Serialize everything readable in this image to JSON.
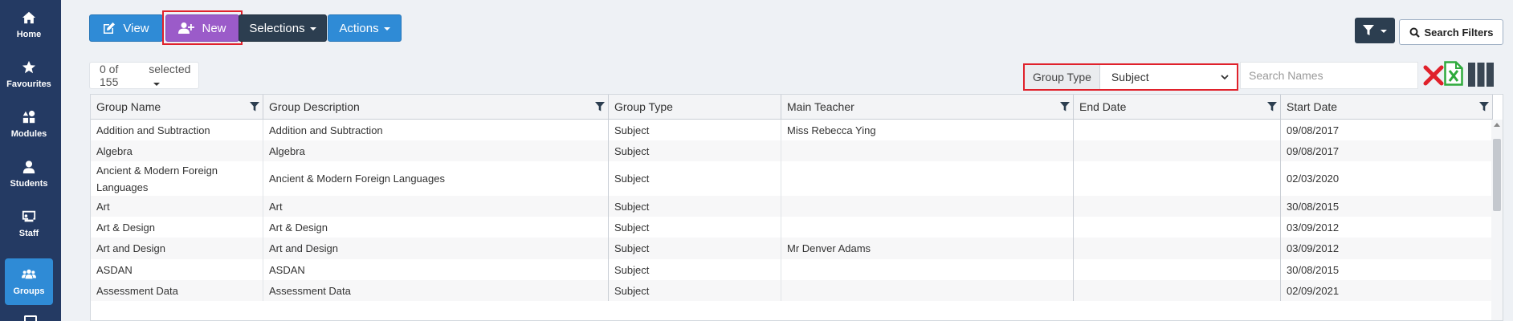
{
  "sidebar": {
    "items": [
      {
        "label": "Home",
        "icon": "home-icon"
      },
      {
        "label": "Favourites",
        "icon": "star-icon"
      },
      {
        "label": "Modules",
        "icon": "shapes-icon"
      },
      {
        "label": "Students",
        "icon": "user-icon"
      },
      {
        "label": "Staff",
        "icon": "chalkboard-icon"
      },
      {
        "label": "Groups",
        "icon": "users-icon",
        "active": true
      }
    ]
  },
  "toolbar": {
    "view_label": "View",
    "new_label": "New",
    "selections_label": "Selections",
    "actions_label": "Actions",
    "search_filters_label": "Search Filters"
  },
  "selection": {
    "count_text": "0 of 155",
    "selected_label": "selected"
  },
  "group_type": {
    "label": "Group Type",
    "value": "Subject"
  },
  "search": {
    "placeholder": "Search Names"
  },
  "table": {
    "columns": [
      "Group Name",
      "Group Description",
      "Group Type",
      "Main Teacher",
      "End Date",
      "Start Date"
    ],
    "rows": [
      [
        "Addition and Subtraction",
        "Addition and Subtraction",
        "Subject",
        "Miss Rebecca Ying",
        "",
        "09/08/2017"
      ],
      [
        "Algebra",
        "Algebra",
        "Subject",
        "",
        "",
        "09/08/2017"
      ],
      [
        "Ancient & Modern Foreign Languages",
        "Ancient & Modern Foreign Languages",
        "Subject",
        "",
        "",
        "02/03/2020"
      ],
      [
        "Art",
        "Art",
        "Subject",
        "",
        "",
        "30/08/2015"
      ],
      [
        "Art & Design",
        "Art & Design",
        "Subject",
        "",
        "",
        "03/09/2012"
      ],
      [
        "Art and Design",
        "Art and Design",
        "Subject",
        "Mr Denver Adams",
        "",
        "03/09/2012"
      ],
      [
        "ASDAN",
        "ASDAN",
        "Subject",
        "",
        "",
        "30/08/2015"
      ],
      [
        "Assessment Data",
        "Assessment Data",
        "Subject",
        "",
        "",
        "02/09/2021"
      ]
    ]
  },
  "colors": {
    "sidebar": "#243a63",
    "primary": "#2f8bd6",
    "new": "#9b5bc9",
    "dark": "#2c3e50",
    "highlight": "#e0212b",
    "excel": "#2eaa3c"
  }
}
